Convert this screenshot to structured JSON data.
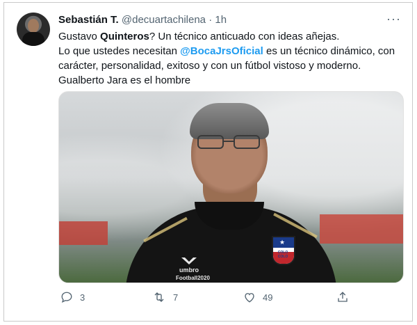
{
  "tweet": {
    "author_name": "Sebastián T.",
    "handle": "@decuartachilena",
    "dot": "·",
    "time": "1h",
    "more": "···",
    "text": {
      "l1_a": "Gustavo ",
      "l1_bold": "Quinteros",
      "l1_b": "? Un técnico anticuado con ideas añejas.",
      "l2_a": "Lo que ustedes necesitan ",
      "l2_mention": "@BocaJrsOficial",
      "l2_b": " es un técnico dinámico, con",
      "l3": "carácter, personalidad, exitoso y con un fútbol vistoso y moderno.",
      "l4": "Gualberto Jara es el hombre"
    },
    "photo": {
      "shirt_brand": "umbro",
      "sponsor": "Football",
      "sponsor_suffix": "2020",
      "badge_text": "COLO COLO"
    },
    "actions": {
      "replies": "3",
      "retweets": "7",
      "likes": "49"
    }
  },
  "colors": {
    "accent": "#1d9bf0",
    "muted": "#536471",
    "text": "#0f1419"
  },
  "icons": [
    "more-icon",
    "reply-icon",
    "retweet-icon",
    "like-icon",
    "share-icon"
  ]
}
